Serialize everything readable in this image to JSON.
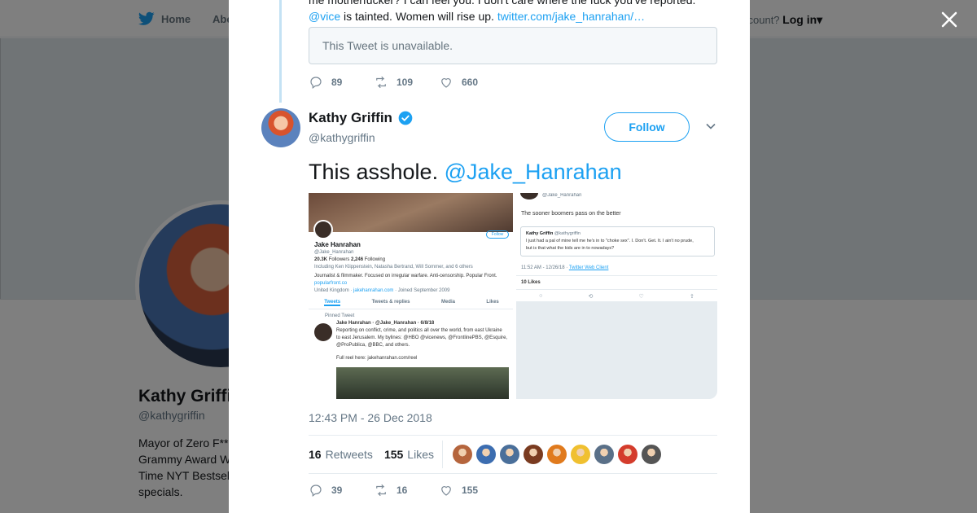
{
  "nav": {
    "home_label": "Home",
    "about_label": "Abo",
    "account_prompt": "ccount?",
    "login_label": "Log in",
    "brand_color": "#1da1f2"
  },
  "profile": {
    "name": "Kathy Griffi",
    "handle": "@kathygriffin",
    "bio_lines": [
      "Mayor of Zero F**",
      "Grammy Award W",
      "Time NYT Bestsel",
      "specials."
    ]
  },
  "modal": {
    "close_icon": "close-icon",
    "previous_tweet": {
      "text_prefix": "is tainted. Women will rise up.",
      "mention": "@vice",
      "link": "twitter.com/jake_hanrahan/…",
      "cut_line": "me motherfucker? I can feel you. I don't care where the fuck you've reported.",
      "unavailable_text": "This Tweet is unavailable.",
      "replies": "89",
      "retweets": "109",
      "likes": "660"
    },
    "tweet": {
      "author_name": "Kathy Griffin",
      "author_handle": "@kathygriffin",
      "follow_label": "Follow",
      "text": "This asshole.",
      "mention": "@Jake_Hanrahan",
      "timestamp": "12:43 PM - 26 Dec 2018",
      "retweet_count": "16",
      "retweet_label": "Retweets",
      "like_count": "155",
      "like_label": "Likes",
      "replies": "39",
      "retweets": "16",
      "likes": "155",
      "liker_colors": [
        "#b5653d",
        "#3c6db0",
        "#4a6f9a",
        "#7a3b20",
        "#e07a1d",
        "#f0c030",
        "#5a7088",
        "#d43c2c",
        "#555555"
      ]
    },
    "media": {
      "left": {
        "follow": "Follow",
        "name": "Jake Hanrahan",
        "handle": "@Jake_Hanrahan",
        "followers_count": "20.3K",
        "followers_label": "Followers",
        "following_count": "2,246",
        "following_label": "Following",
        "including": "Including Ken Klippenstein, Natasha Bertrand, Will Sommer, and 6 others",
        "bio": "Journalist & filmmaker. Focused on irregular warfare. Anti-censorship. Popular Front.",
        "url": "popularfront.co",
        "location": "United Kingdom",
        "website": "jakehanrahan.com",
        "joined": "Joined September 2009",
        "tabs": [
          "Tweets",
          "Tweets & replies",
          "Media",
          "Likes"
        ],
        "pinned_label": "Pinned Tweet",
        "pinned_header": "Jake Hanrahan · @Jake_Hanrahan · 6/8/18",
        "pinned_line1": "Reporting on conflict, crime, and politics all over the world, from east Ukraine",
        "pinned_line2": "to east Jerusalem. My bylines: @HBO @vicenews, @FrontlinePBS, @Esquire,",
        "pinned_line3": "@ProPublica, @BBC, and others.",
        "reel": "Full reel here: jakehanrahan.com/reel"
      },
      "right": {
        "handle": "@Jake_Hanrahan",
        "text": "The sooner boomers pass on the better",
        "quote_author": "Kathy Griffin",
        "quote_handle": "@kathygriffin",
        "quote_line1": "I just had a pal of mine tell me he's in to \"choke sex\". I. Don't. Get. It. I ain't no prude,",
        "quote_line2": "but is that what the kids are in to nowadays?",
        "time": "11:52 AM - 12/26/18",
        "client": "Twitter Web Client",
        "likes": "10 Likes"
      }
    }
  }
}
